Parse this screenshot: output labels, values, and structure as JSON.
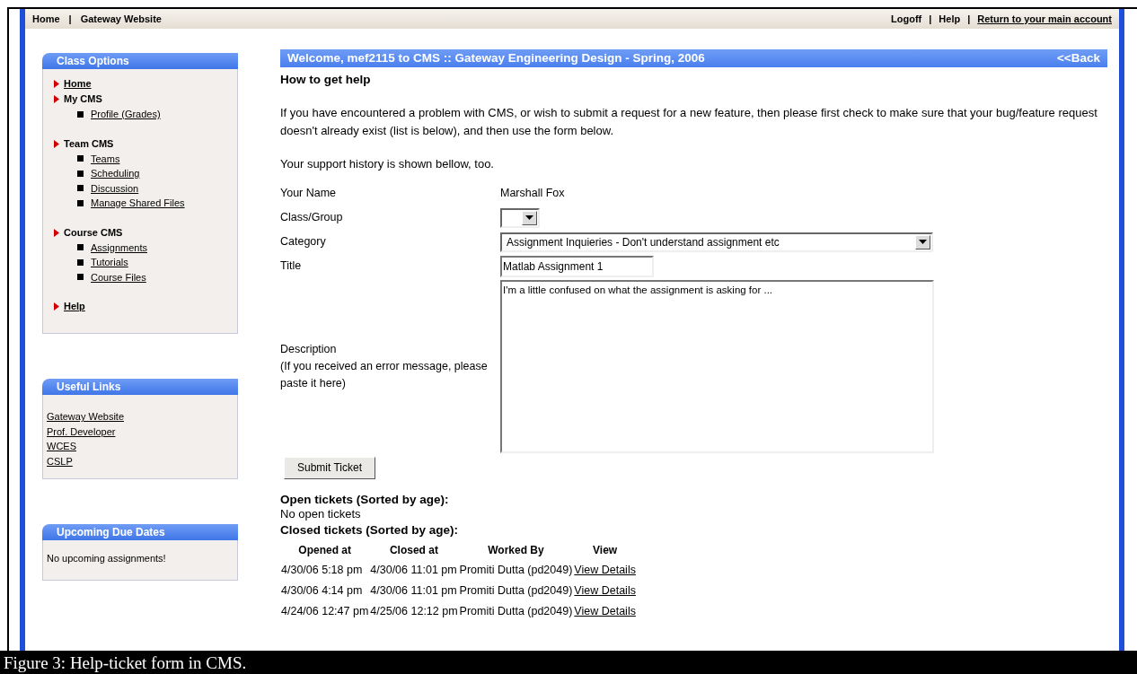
{
  "top_nav": {
    "separator": "|",
    "left": [
      "Home",
      "Gateway Website"
    ],
    "right": [
      {
        "label": "Logoff",
        "kind": "plain"
      },
      {
        "label": "Help",
        "kind": "plain"
      },
      {
        "label": "Return to your main account",
        "kind": "link"
      }
    ]
  },
  "sidebar": {
    "panels": [
      {
        "title": "Class Options",
        "kind": "menu",
        "items": [
          {
            "label": "Home",
            "kind": "link"
          },
          {
            "label": "My CMS",
            "kind": "heading",
            "children": [
              "Profile (Grades)"
            ]
          },
          {
            "label": "Team CMS",
            "kind": "heading",
            "children": [
              "Teams",
              "Scheduling",
              "Discussion",
              "Manage Shared Files"
            ]
          },
          {
            "label": "Course CMS",
            "kind": "heading",
            "children": [
              "Assignments",
              "Tutorials",
              "Course Files"
            ]
          },
          {
            "label": "Help",
            "kind": "link"
          }
        ]
      },
      {
        "title": "Useful Links",
        "kind": "links",
        "links": [
          "Gateway Website",
          "Prof. Developer",
          "WCES",
          "CSLP"
        ]
      },
      {
        "title": "Upcoming Due Dates",
        "kind": "text",
        "text": "No upcoming assignments!"
      }
    ]
  },
  "main": {
    "banner": {
      "title": "Welcome, mef2115 to CMS :: Gateway Engineering Design - Spring, 2006",
      "back": "<<Back"
    },
    "heading": "How to get help",
    "intro": "If you have encountered a problem with CMS, or wish to submit a request for a new feature, then please first check to make sure that your bug/feature request doesn't already exist (list is below), and then use the form below.",
    "note": "Your support history is shown bellow, too.",
    "form": [
      {
        "label": "Your Name",
        "kind": "text",
        "value": "Marshall Fox"
      },
      {
        "label": "Class/Group",
        "kind": "select_small"
      },
      {
        "label": "Category",
        "kind": "select",
        "value": "Assignment Inquieries - Don't understand assignment etc"
      },
      {
        "label": "Title",
        "kind": "input",
        "value": "Matlab Assignment 1"
      },
      {
        "label": "Description",
        "hint": "(If you received an error message, please paste it here)",
        "kind": "textarea",
        "value": "I'm a little confused on what the assignment is asking for ..."
      }
    ],
    "submit": "Submit Ticket",
    "open_heading": "Open tickets (Sorted by age):",
    "open_empty": "No open tickets",
    "closed_heading": "Closed tickets (Sorted by age):",
    "table": {
      "columns": [
        "Opened at",
        "Closed at",
        "Worked By",
        "View"
      ],
      "rows": [
        [
          "4/30/06 5:18 pm",
          "4/30/06 11:01 pm",
          "Promiti Dutta (pd2049)",
          "View Details"
        ],
        [
          "4/30/06 4:14 pm",
          "4/30/06 11:01 pm",
          "Promiti Dutta (pd2049)",
          "View Details"
        ],
        [
          "4/24/06 12:47 pm",
          "4/25/06 12:12 pm",
          "Promiti Dutta (pd2049)",
          "View Details"
        ]
      ]
    }
  },
  "caption": "Figure 3: Help-ticket form in CMS."
}
